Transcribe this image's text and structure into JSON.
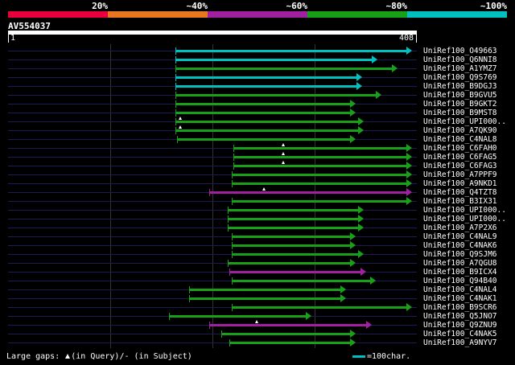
{
  "scale": {
    "labels": [
      "20%",
      "~40%",
      "~60%",
      "~80%",
      "~100%"
    ],
    "colors": [
      "#e8003c",
      "#e87820",
      "#a020a0",
      "#18a018",
      "#00c0c0"
    ]
  },
  "query": {
    "name": "AV554037",
    "start": "1",
    "end": "408",
    "length": 408
  },
  "legend": {
    "gaps_prefix": "Large gaps: ",
    "gaps_query": "(in Query)/",
    "gaps_subject": "- (in Subject)",
    "swatch_text": "=100char."
  },
  "hits": [
    {
      "label": "UniRef100_O49663",
      "start": 167,
      "end": 403,
      "color": "#00c0c0",
      "gaps": []
    },
    {
      "label": "UniRef100_Q6NNI8",
      "start": 167,
      "end": 369,
      "color": "#00c0c0",
      "gaps": []
    },
    {
      "label": "UniRef100_A1YMZ7",
      "start": 167,
      "end": 389,
      "color": "#18a018",
      "gaps": []
    },
    {
      "label": "UniRef100_Q9S769",
      "start": 167,
      "end": 353,
      "color": "#00c0c0",
      "gaps": []
    },
    {
      "label": "UniRef100_B9DGJ3",
      "start": 167,
      "end": 353,
      "color": "#00c0c0",
      "gaps": []
    },
    {
      "label": "UniRef100_B9GVU5",
      "start": 167,
      "end": 373,
      "color": "#18a018",
      "gaps": []
    },
    {
      "label": "UniRef100_B9GKT2",
      "start": 167,
      "end": 347,
      "color": "#18a018",
      "gaps": []
    },
    {
      "label": "UniRef100_B9MST8",
      "start": 167,
      "end": 347,
      "color": "#18a018",
      "gaps": []
    },
    {
      "label": "UniRef100_UPI000..",
      "start": 167,
      "end": 355,
      "color": "#18a018",
      "gaps": [
        172
      ]
    },
    {
      "label": "UniRef100_A7QK90",
      "start": 167,
      "end": 355,
      "color": "#18a018",
      "gaps": [
        172
      ]
    },
    {
      "label": "UniRef100_C4NAL8",
      "start": 169,
      "end": 347,
      "color": "#18a018",
      "gaps": []
    },
    {
      "label": "UniRef100_C6FAH0",
      "start": 225,
      "end": 403,
      "color": "#18a018",
      "gaps": [
        275
      ]
    },
    {
      "label": "UniRef100_C6FAG5",
      "start": 225,
      "end": 403,
      "color": "#18a018",
      "gaps": [
        275
      ]
    },
    {
      "label": "UniRef100_C6FAG3",
      "start": 225,
      "end": 403,
      "color": "#18a018",
      "gaps": [
        275
      ]
    },
    {
      "label": "UniRef100_A7PPF9",
      "start": 223,
      "end": 403,
      "color": "#18a018",
      "gaps": []
    },
    {
      "label": "UniRef100_A9NKD1",
      "start": 223,
      "end": 403,
      "color": "#18a018",
      "gaps": []
    },
    {
      "label": "UniRef100_Q4TZT8",
      "start": 201,
      "end": 403,
      "color": "#a020a0",
      "gaps": [
        255
      ]
    },
    {
      "label": "UniRef100_B3IX31",
      "start": 223,
      "end": 403,
      "color": "#18a018",
      "gaps": []
    },
    {
      "label": "UniRef100_UPI000..",
      "start": 219,
      "end": 355,
      "color": "#18a018",
      "gaps": []
    },
    {
      "label": "UniRef100_UPI000..",
      "start": 219,
      "end": 355,
      "color": "#18a018",
      "gaps": []
    },
    {
      "label": "UniRef100_A7P2X6",
      "start": 219,
      "end": 355,
      "color": "#18a018",
      "gaps": []
    },
    {
      "label": "UniRef100_C4NAL9",
      "start": 223,
      "end": 347,
      "color": "#18a018",
      "gaps": []
    },
    {
      "label": "UniRef100_C4NAK6",
      "start": 223,
      "end": 347,
      "color": "#18a018",
      "gaps": []
    },
    {
      "label": "UniRef100_Q9SJM6",
      "start": 223,
      "end": 355,
      "color": "#18a018",
      "gaps": []
    },
    {
      "label": "UniRef100_A7QGU8",
      "start": 219,
      "end": 347,
      "color": "#18a018",
      "gaps": []
    },
    {
      "label": "UniRef100_B9ICX4",
      "start": 221,
      "end": 357,
      "color": "#a020a0",
      "gaps": []
    },
    {
      "label": "UniRef100_Q94B40",
      "start": 223,
      "end": 367,
      "color": "#18a018",
      "gaps": []
    },
    {
      "label": "UniRef100_C4NAL4",
      "start": 181,
      "end": 337,
      "color": "#18a018",
      "gaps": []
    },
    {
      "label": "UniRef100_C4NAK1",
      "start": 181,
      "end": 337,
      "color": "#18a018",
      "gaps": []
    },
    {
      "label": "UniRef100_B9SCR6",
      "start": 223,
      "end": 403,
      "color": "#18a018",
      "gaps": []
    },
    {
      "label": "UniRef100_Q5JNO7",
      "start": 161,
      "end": 303,
      "color": "#18a018",
      "gaps": []
    },
    {
      "label": "UniRef100_Q9ZNU9",
      "start": 201,
      "end": 363,
      "color": "#a020a0",
      "gaps": [
        248
      ]
    },
    {
      "label": "UniRef100_C4NAK5",
      "start": 213,
      "end": 347,
      "color": "#18a018",
      "gaps": []
    },
    {
      "label": "UniRef100_A9NYV7",
      "start": 221,
      "end": 347,
      "color": "#18a018",
      "gaps": []
    }
  ]
}
